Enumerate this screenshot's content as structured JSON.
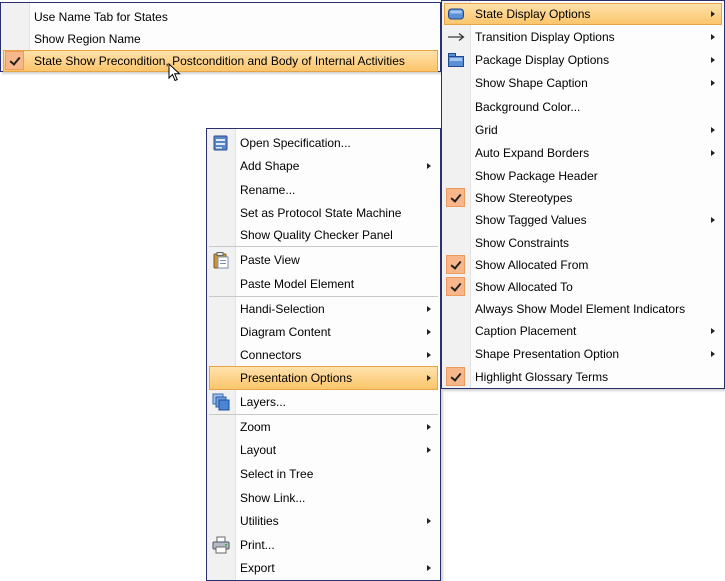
{
  "colors": {
    "menu_border": "#2a2f6e",
    "highlight_top": "#ffe2ac",
    "highlight_bottom": "#fbc56b",
    "check_bg": "#f8b78a"
  },
  "top_menu": {
    "items": [
      {
        "label": "Use Name Tab for States",
        "checked": false
      },
      {
        "label": "Show Region Name",
        "checked": false
      },
      {
        "label": "State Show Precondition, Postcondition and Body of Internal Activities",
        "checked": true,
        "highlighted": true
      }
    ]
  },
  "context_menu": {
    "items": [
      {
        "label": "Open Specification...",
        "icon": "open-specification-icon"
      },
      {
        "label": "Add Shape",
        "submenu": true
      },
      {
        "label": "Rename..."
      },
      {
        "label": "Set as Protocol State Machine"
      },
      {
        "label": "Show Quality Checker Panel"
      },
      {
        "label": "Paste View",
        "icon": "clipboard-icon"
      },
      {
        "label": "Paste Model Element"
      },
      {
        "label": "Handi-Selection",
        "submenu": true
      },
      {
        "label": "Diagram Content",
        "submenu": true
      },
      {
        "label": "Connectors",
        "submenu": true
      },
      {
        "label": "Presentation Options",
        "submenu": true,
        "highlighted": true
      },
      {
        "label": "Layers...",
        "icon": "layers-icon"
      },
      {
        "label": "Zoom",
        "submenu": true
      },
      {
        "label": "Layout",
        "submenu": true
      },
      {
        "label": "Select in Tree"
      },
      {
        "label": "Show Link..."
      },
      {
        "label": "Utilities",
        "submenu": true
      },
      {
        "label": "Print...",
        "icon": "printer-icon"
      },
      {
        "label": "Export",
        "submenu": true
      }
    ]
  },
  "presentation_menu": {
    "items": [
      {
        "label": "State Display Options",
        "icon": "state-shape-icon",
        "submenu": true,
        "highlighted": true
      },
      {
        "label": "Transition Display Options",
        "icon": "transition-arrow-icon",
        "submenu": true
      },
      {
        "label": "Package Display Options",
        "icon": "package-shape-icon",
        "submenu": true
      },
      {
        "label": "Show Shape Caption",
        "submenu": true
      },
      {
        "label": "Background Color..."
      },
      {
        "label": "Grid",
        "submenu": true
      },
      {
        "label": "Auto Expand Borders",
        "submenu": true
      },
      {
        "label": "Show Package Header"
      },
      {
        "label": "Show Stereotypes",
        "checked": true
      },
      {
        "label": "Show Tagged Values",
        "submenu": true
      },
      {
        "label": "Show Constraints"
      },
      {
        "label": "Show Allocated From",
        "checked": true
      },
      {
        "label": "Show Allocated To",
        "checked": true
      },
      {
        "label": "Always Show Model Element Indicators"
      },
      {
        "label": "Caption Placement",
        "submenu": true
      },
      {
        "label": "Shape Presentation Option",
        "submenu": true
      },
      {
        "label": "Highlight Glossary Terms",
        "checked": true
      }
    ]
  }
}
